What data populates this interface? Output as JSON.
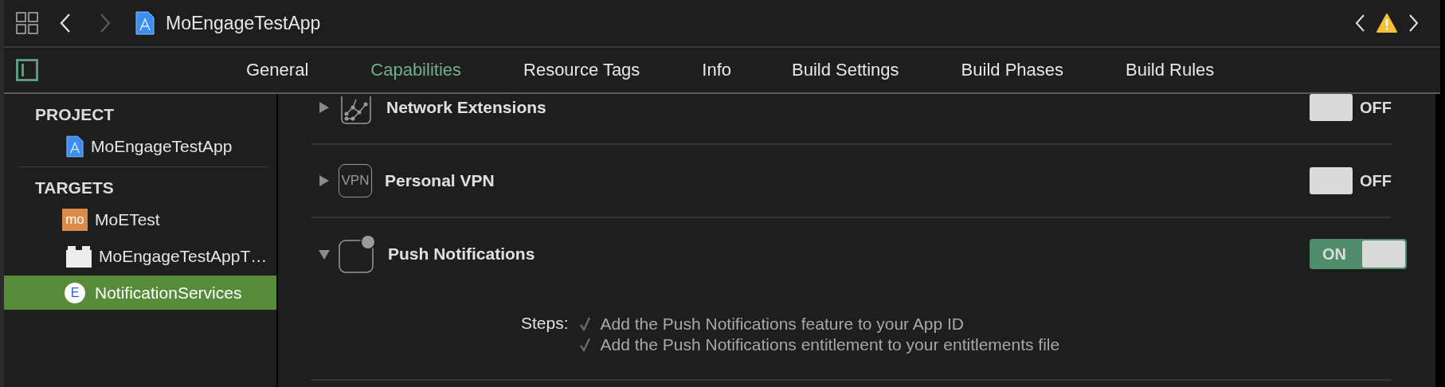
{
  "toolbar": {
    "title": "MoEngageTestApp",
    "back_disabled": false,
    "forward_disabled": true
  },
  "tabs": [
    {
      "label": "General",
      "selected": false
    },
    {
      "label": "Capabilities",
      "selected": true
    },
    {
      "label": "Resource Tags",
      "selected": false
    },
    {
      "label": "Info",
      "selected": false
    },
    {
      "label": "Build Settings",
      "selected": false
    },
    {
      "label": "Build Phases",
      "selected": false
    },
    {
      "label": "Build Rules",
      "selected": false
    }
  ],
  "sidebar": {
    "sections": [
      {
        "title": "PROJECT",
        "items": [
          {
            "kind": "project",
            "label": "MoEngageTestApp",
            "selected": false
          }
        ]
      },
      {
        "title": "TARGETS",
        "items": [
          {
            "kind": "app",
            "icon_text": "mo",
            "label": "MoETest",
            "selected": false
          },
          {
            "kind": "bundle",
            "label": "MoEngageTestAppT…",
            "selected": false
          },
          {
            "kind": "extension",
            "icon_text": "E",
            "label": "NotificationServices",
            "selected": true
          }
        ]
      }
    ]
  },
  "capabilities": [
    {
      "kind": "network",
      "name": "Network Extensions",
      "expanded": false,
      "on": false,
      "switch_text": "OFF"
    },
    {
      "kind": "vpn",
      "icon_text": "VPN",
      "name": "Personal VPN",
      "expanded": false,
      "on": false,
      "switch_text": "OFF"
    },
    {
      "kind": "push",
      "name": "Push Notifications",
      "expanded": true,
      "on": true,
      "switch_text": "ON",
      "steps_label": "Steps:",
      "steps": [
        {
          "text": "Add the Push Notifications feature to your App ID",
          "done": true
        },
        {
          "text": "Add the Push Notifications entitlement to your entitlements file",
          "done": true
        }
      ]
    }
  ]
}
